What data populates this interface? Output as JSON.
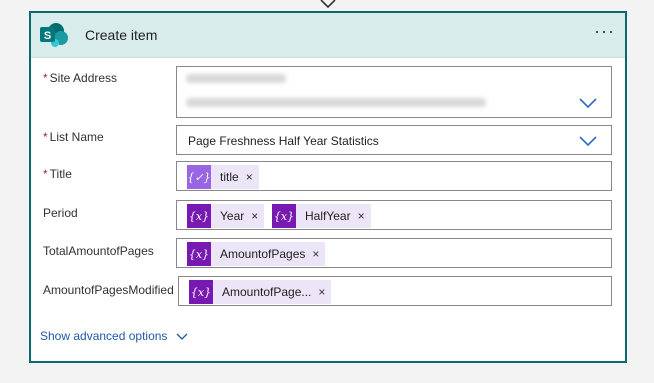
{
  "card": {
    "title": "Create item",
    "more_label": "···",
    "logo_letter": "S"
  },
  "fields": {
    "site_address": {
      "label": "Site Address",
      "required": "*"
    },
    "list_name": {
      "label": "List Name",
      "required": "*",
      "value": "Page Freshness Half Year Statistics"
    },
    "title": {
      "label": "Title",
      "required": "*",
      "tokens": [
        {
          "text": "title",
          "icon": "expression-icon"
        }
      ]
    },
    "period": {
      "label": "Period",
      "tokens": [
        {
          "text": "Year",
          "icon": "variable-icon"
        },
        {
          "text": "HalfYear",
          "icon": "variable-icon"
        }
      ]
    },
    "total_amount_of_pages": {
      "label": "TotalAmountofPages",
      "tokens": [
        {
          "text": "AmountofPages",
          "icon": "variable-icon"
        }
      ]
    },
    "amount_of_pages_modified": {
      "label": "AmountofPagesModified",
      "tokens": [
        {
          "text": "AmountofPage...",
          "icon": "variable-icon"
        }
      ]
    }
  },
  "token_remove": "×",
  "icon_glyphs": {
    "variable": "{x}",
    "expression": "{✓}"
  },
  "show_advanced": "Show advanced options",
  "colors": {
    "accent": "#0b6a70",
    "header_bg": "#d9ecec",
    "token_bg": "#ece4f7",
    "variable_icon": "#7819b2",
    "expression_icon": "#9866e3",
    "link": "#1f5aa6",
    "required": "#a4262c"
  }
}
